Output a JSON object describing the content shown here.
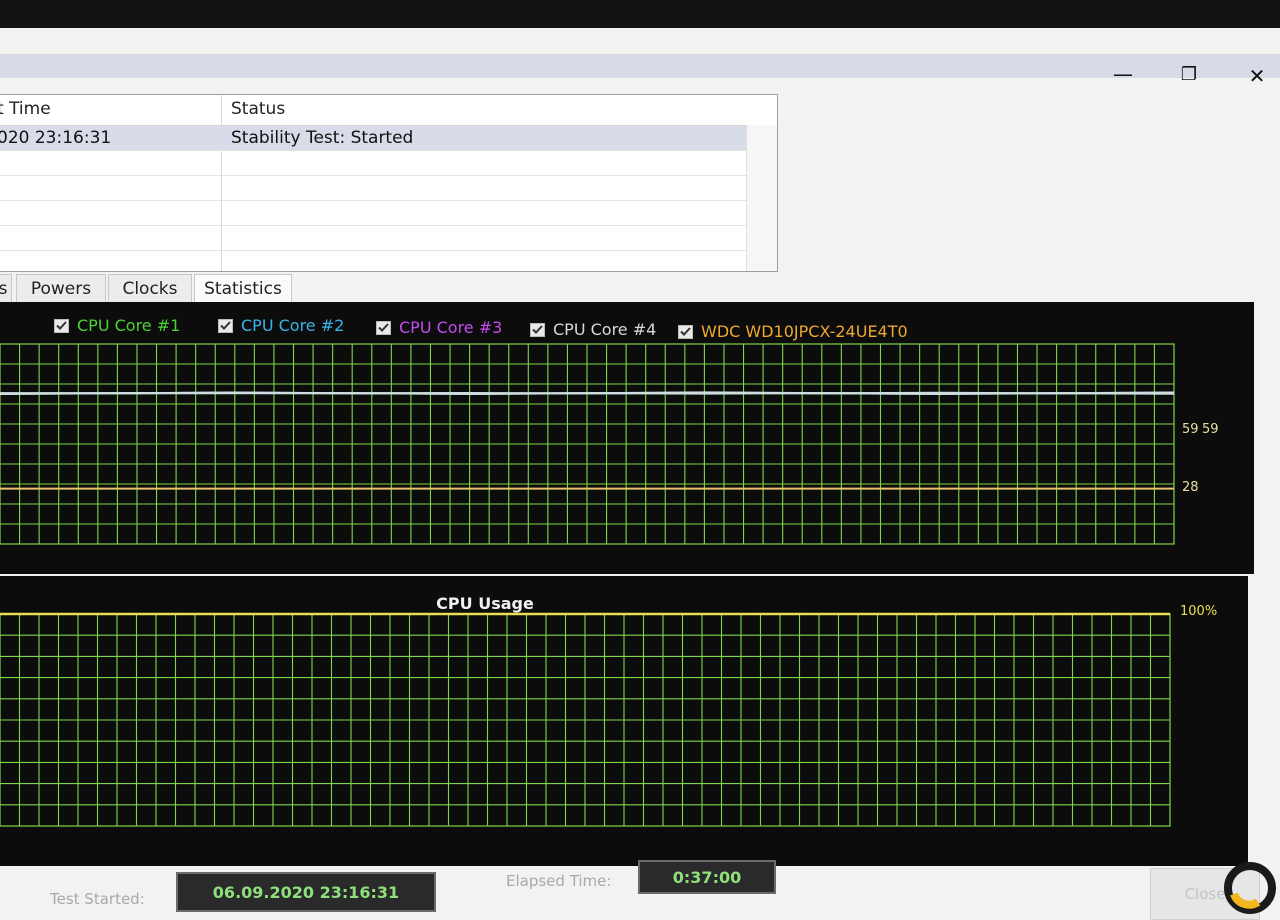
{
  "window": {
    "minimize_glyph": "—",
    "maximize_glyph": "❐",
    "close_glyph": "✕"
  },
  "log": {
    "columns": [
      "t Time",
      "Status"
    ],
    "rows": [
      {
        "time": "020 23:16:31",
        "status": "Stability Test: Started"
      }
    ]
  },
  "tabs": [
    {
      "label": "s"
    },
    {
      "label": "Powers"
    },
    {
      "label": "Clocks"
    },
    {
      "label": "Statistics"
    }
  ],
  "temp_chart": {
    "legend": [
      {
        "label": "CPU Core #1",
        "color": "#4cd137",
        "checked": true
      },
      {
        "label": "CPU Core #2",
        "color": "#38b6e8",
        "checked": true
      },
      {
        "label": "CPU Core #3",
        "color": "#c34cf0",
        "checked": true
      },
      {
        "label": "CPU Core #4",
        "color": "#d8d8d8",
        "checked": true
      },
      {
        "label": "WDC WD10JPCX-24UE4T0",
        "color": "#f0a830",
        "checked": true
      }
    ],
    "value_labels": {
      "cpu_a": "59",
      "cpu_b": "59",
      "disk": "28"
    },
    "colors": {
      "grid": "#7fd64a",
      "cpu_line": "#d0dde0",
      "disk_line": "#e8c46a",
      "value_text": "#e8e0a0"
    }
  },
  "chart_data": [
    {
      "type": "line",
      "title": "",
      "series": [
        {
          "name": "CPU Core #1",
          "values": [
            59,
            59,
            59,
            59,
            59,
            59
          ]
        },
        {
          "name": "CPU Core #2",
          "values": [
            59,
            59,
            59,
            59,
            59,
            59
          ]
        },
        {
          "name": "CPU Core #3",
          "values": [
            59,
            59,
            59,
            59,
            59,
            59
          ]
        },
        {
          "name": "CPU Core #4",
          "values": [
            59,
            59,
            59,
            59,
            59,
            59
          ]
        },
        {
          "name": "WDC WD10JPCX-24UE4T0",
          "values": [
            28,
            28,
            28,
            28,
            28,
            28
          ]
        }
      ],
      "grid": true
    },
    {
      "type": "line",
      "title": "CPU Usage",
      "series": [
        {
          "name": "",
          "values": [
            100,
            100,
            100,
            100,
            100,
            100
          ]
        }
      ],
      "max_label": "100%",
      "grid": true
    }
  ],
  "usage_chart": {
    "title": "CPU Usage",
    "max_label": "100%",
    "colors": {
      "grid": "#7fd64a",
      "line": "#e8e050",
      "label": "#e8e050"
    }
  },
  "footer": {
    "test_started_label": "Test Started:",
    "test_started_value": "06.09.2020 23:16:31",
    "elapsed_label": "Elapsed Time:",
    "elapsed_value": "0:37:00",
    "close_label": "Close"
  }
}
